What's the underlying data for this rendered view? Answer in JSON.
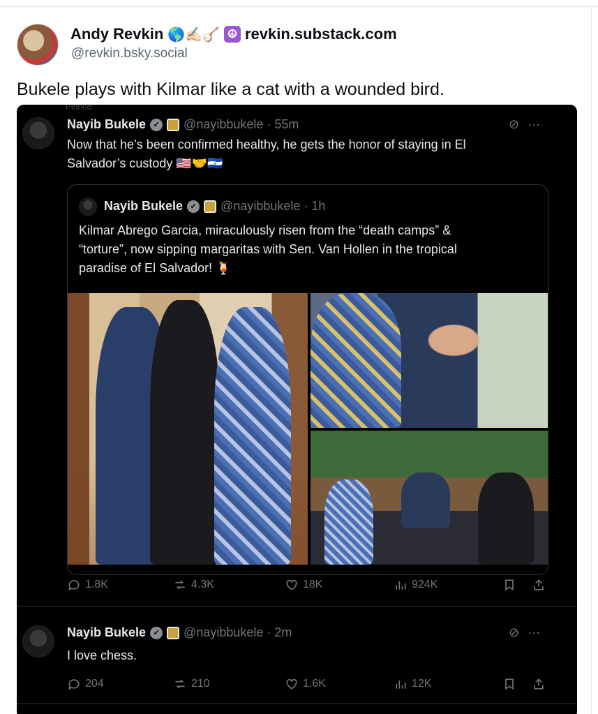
{
  "bluesky_post": {
    "author_name": "Andy Revkin",
    "author_emojis": "🌎✍🏻🪕",
    "author_site": "revkin.substack.com",
    "author_handle": "@revkin.bsky.social",
    "text": "Bukele plays with Kilmar like a cat with a wounded bird."
  },
  "embedded": {
    "top_cut_text": "Pinned",
    "tweet1": {
      "name": "Nayib Bukele",
      "handle": "@nayibbukele · 55m",
      "line1": "Now that he’s been confirmed healthy, he gets the honor of staying in El",
      "line2": "Salvador’s custody 🇺🇸🤝🇸🇻",
      "quote": {
        "name": "Nayib Bukele",
        "handle": "@nayibbukele · 1h",
        "line1": "Kilmar Abrego Garcia, miraculously risen from the “death camps” &",
        "line2": "“torture”, now sipping margaritas with Sen. Van Hollen in the tropical",
        "line3": "paradise of El Salvador! 🍹"
      },
      "replies": "1.8K",
      "reposts": "4.3K",
      "likes": "18K",
      "views": "924K"
    },
    "tweet2": {
      "name": "Nayib Bukele",
      "handle": "@nayibbukele · 2m",
      "text": "I love chess.",
      "replies": "204",
      "reposts": "210",
      "likes": "1.6K",
      "views": "12K"
    }
  },
  "icons": {
    "globe": "globe-icon",
    "peace": "peace-icon",
    "verified": "verified-badge-icon",
    "reply": "reply-icon",
    "repost": "repost-icon",
    "like": "heart-icon",
    "views": "views-icon",
    "bookmark": "bookmark-icon",
    "share": "share-icon",
    "grok": "grok-icon",
    "more": "more-icon"
  },
  "colors": {
    "embed_bg": "#000000",
    "tw_text": "#e7e9ea",
    "tw_muted": "#71767b",
    "peace_badge": "#9b59d0"
  }
}
